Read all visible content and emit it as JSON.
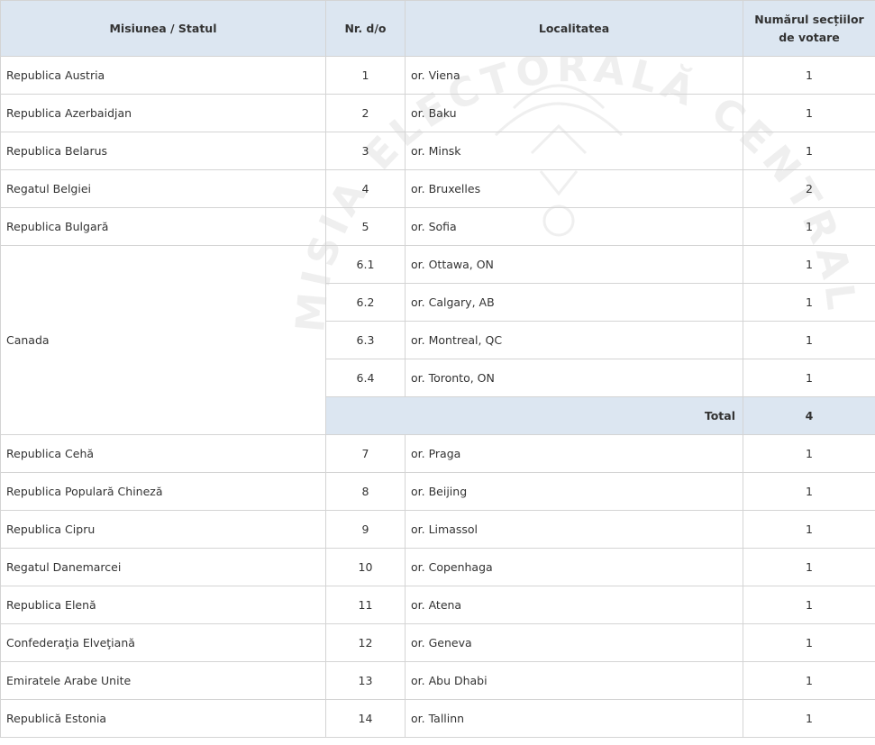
{
  "table": {
    "headers": [
      "Misiunea / Statul",
      "Nr. d/o",
      "Localitatea",
      "Numărul secțiilor de votare"
    ],
    "rows": [
      {
        "state": "Republica Austria",
        "nr": "1",
        "loc": "or. Viena",
        "count": "1"
      },
      {
        "state": "Republica Azerbaidjan",
        "nr": "2",
        "loc": "or. Baku",
        "count": "1"
      },
      {
        "state": "Republica Belarus",
        "nr": "3",
        "loc": "or. Minsk",
        "count": "1"
      },
      {
        "state": "Regatul Belgiei",
        "nr": "4",
        "loc": "or. Bruxelles",
        "count": "2"
      },
      {
        "state": "Republica Bulgară",
        "nr": "5",
        "loc": "or. Sofia",
        "count": "1"
      }
    ],
    "canada": {
      "state": "Canada",
      "rows": [
        {
          "nr": "6.1",
          "loc": "or. Ottawa, ON",
          "count": "1"
        },
        {
          "nr": "6.2",
          "loc": "or. Calgary, AB",
          "count": "1"
        },
        {
          "nr": "6.3",
          "loc": "or. Montreal, QC",
          "count": "1"
        },
        {
          "nr": "6.4",
          "loc": "or. Toronto, ON",
          "count": "1"
        }
      ],
      "total_label": "Total",
      "total_value": "4"
    },
    "rows_after": [
      {
        "state": "Republica Cehă",
        "nr": "7",
        "loc": "or. Praga",
        "count": "1"
      },
      {
        "state": "Republica Populară Chineză",
        "nr": "8",
        "loc": "or. Beijing",
        "count": "1"
      },
      {
        "state": "Republica Cipru",
        "nr": "9",
        "loc": "or. Limassol",
        "count": "1"
      },
      {
        "state": "Regatul Danemarcei",
        "nr": "10",
        "loc": "or. Copenhaga",
        "count": "1"
      },
      {
        "state": "Republica Elenă",
        "nr": "11",
        "loc": "or. Atena",
        "count": "1"
      },
      {
        "state": "Confederaţia Elveţiană",
        "nr": "12",
        "loc": "or. Geneva",
        "count": "1"
      },
      {
        "state": "Emiratele Arabe Unite",
        "nr": "13",
        "loc": "or. Abu Dhabi",
        "count": "1"
      },
      {
        "state": "Republică Estonia",
        "nr": "14",
        "loc": "or. Tallinn",
        "count": "1"
      }
    ]
  },
  "watermark": {
    "text": "MISIA ELECTORALĂ CENTRALĂ",
    "color": "#ececec"
  }
}
